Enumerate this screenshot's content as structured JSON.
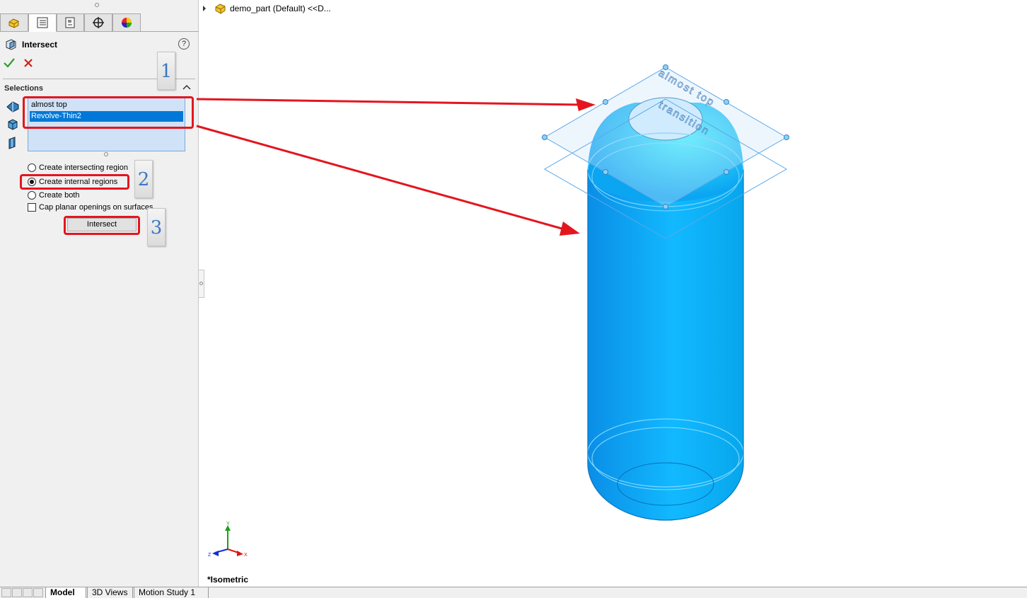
{
  "panel": {
    "tabs": [
      {
        "icon": "feature-manager-icon"
      },
      {
        "icon": "property-manager-icon"
      },
      {
        "icon": "configuration-manager-icon"
      },
      {
        "icon": "dimxpert-icon"
      },
      {
        "icon": "display-manager-icon"
      }
    ],
    "title": "Intersect",
    "help_label": "?",
    "selections_label": "Selections",
    "selection_items": [
      "almost top",
      "Revolve-Thin2"
    ],
    "options": {
      "intersecting": "Create intersecting region",
      "internal": "Create internal regions",
      "both": "Create both",
      "cap": "Cap planar openings on surfaces"
    },
    "selected_option": "internal",
    "intersect_button": "Intersect"
  },
  "callouts": [
    "1",
    "2",
    "3"
  ],
  "tree": {
    "part_name": "demo_part (Default) <<D..."
  },
  "viewport": {
    "plane_labels": [
      "almost top",
      "transition"
    ],
    "view_name": "*Isometric",
    "triad": {
      "x": "X",
      "y": "Y",
      "z": "Z"
    }
  },
  "bottom_tabs": [
    "Model",
    "3D Views",
    "Motion Study 1"
  ],
  "active_bottom_tab": "Model",
  "colors": {
    "accent": "#0078d7",
    "highlight_red": "#e3161f",
    "body_blue": "#00b0ff",
    "callout_text": "#3a78c4"
  }
}
